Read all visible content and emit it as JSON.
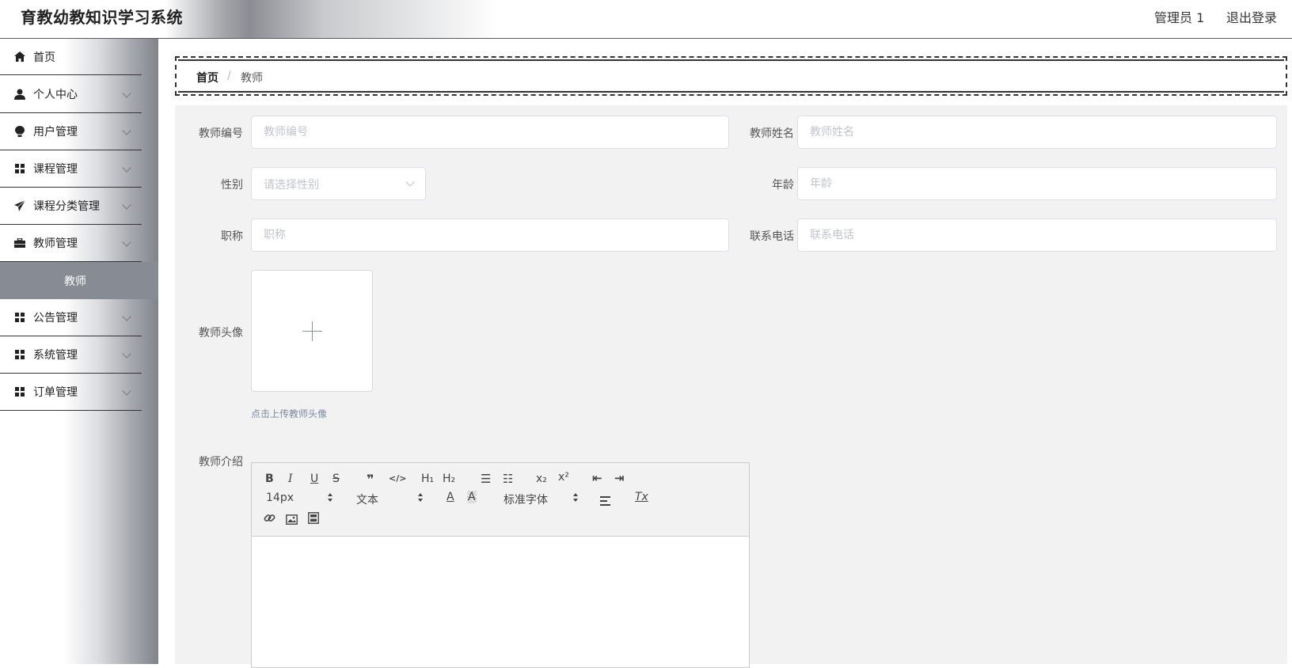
{
  "header": {
    "app_title": "育教幼教知识学习系统",
    "user": "管理员 1",
    "logout": "退出登录"
  },
  "sidebar": {
    "items": [
      {
        "label": "首页",
        "icon": "home-icon"
      },
      {
        "label": "个人中心",
        "icon": "user-icon"
      },
      {
        "label": "用户管理",
        "icon": "bulb-icon"
      },
      {
        "label": "课程管理",
        "icon": "grid-icon"
      },
      {
        "label": "课程分类管理",
        "icon": "send-icon"
      },
      {
        "label": "教师管理",
        "icon": "briefcase-icon"
      },
      {
        "label": "公告管理",
        "icon": "grid-icon"
      },
      {
        "label": "系统管理",
        "icon": "grid-icon"
      },
      {
        "label": "订单管理",
        "icon": "grid-icon"
      }
    ],
    "active_sub": "教师"
  },
  "breadcrumb": {
    "home": "首页",
    "separator": "/",
    "current": "教师"
  },
  "form": {
    "teacher_no": {
      "label": "教师编号",
      "placeholder": "教师编号",
      "value": ""
    },
    "teacher_name": {
      "label": "教师姓名",
      "placeholder": "教师姓名",
      "value": ""
    },
    "gender": {
      "label": "性别",
      "placeholder": "请选择性别",
      "value": ""
    },
    "age": {
      "label": "年龄",
      "placeholder": "年龄",
      "value": ""
    },
    "title": {
      "label": "职称",
      "placeholder": "职称",
      "value": ""
    },
    "phone": {
      "label": "联系电话",
      "placeholder": "联系电话",
      "value": ""
    },
    "avatar": {
      "label": "教师头像",
      "tip": "点击上传教师头像"
    },
    "intro": {
      "label": "教师介绍"
    }
  },
  "editor_toolbar": {
    "bold": "B",
    "italic": "I",
    "underline": "U",
    "strike": "S",
    "blockquote": "❞",
    "code": "</>",
    "h1": "H₁",
    "h2": "H₂",
    "ordered_list": "☰",
    "bullet_list": "☷",
    "subscript": "x₂",
    "superscript": "x²",
    "outdent": "⇤",
    "indent": "⇥",
    "font_size": "14px",
    "header_select": "文本",
    "font_family": "标准字体",
    "clean": "Tx"
  },
  "colors": {
    "sidebar_active_bg": "#878b93",
    "form_bg": "#f2f2f2",
    "placeholder": "#c0c4cc"
  }
}
